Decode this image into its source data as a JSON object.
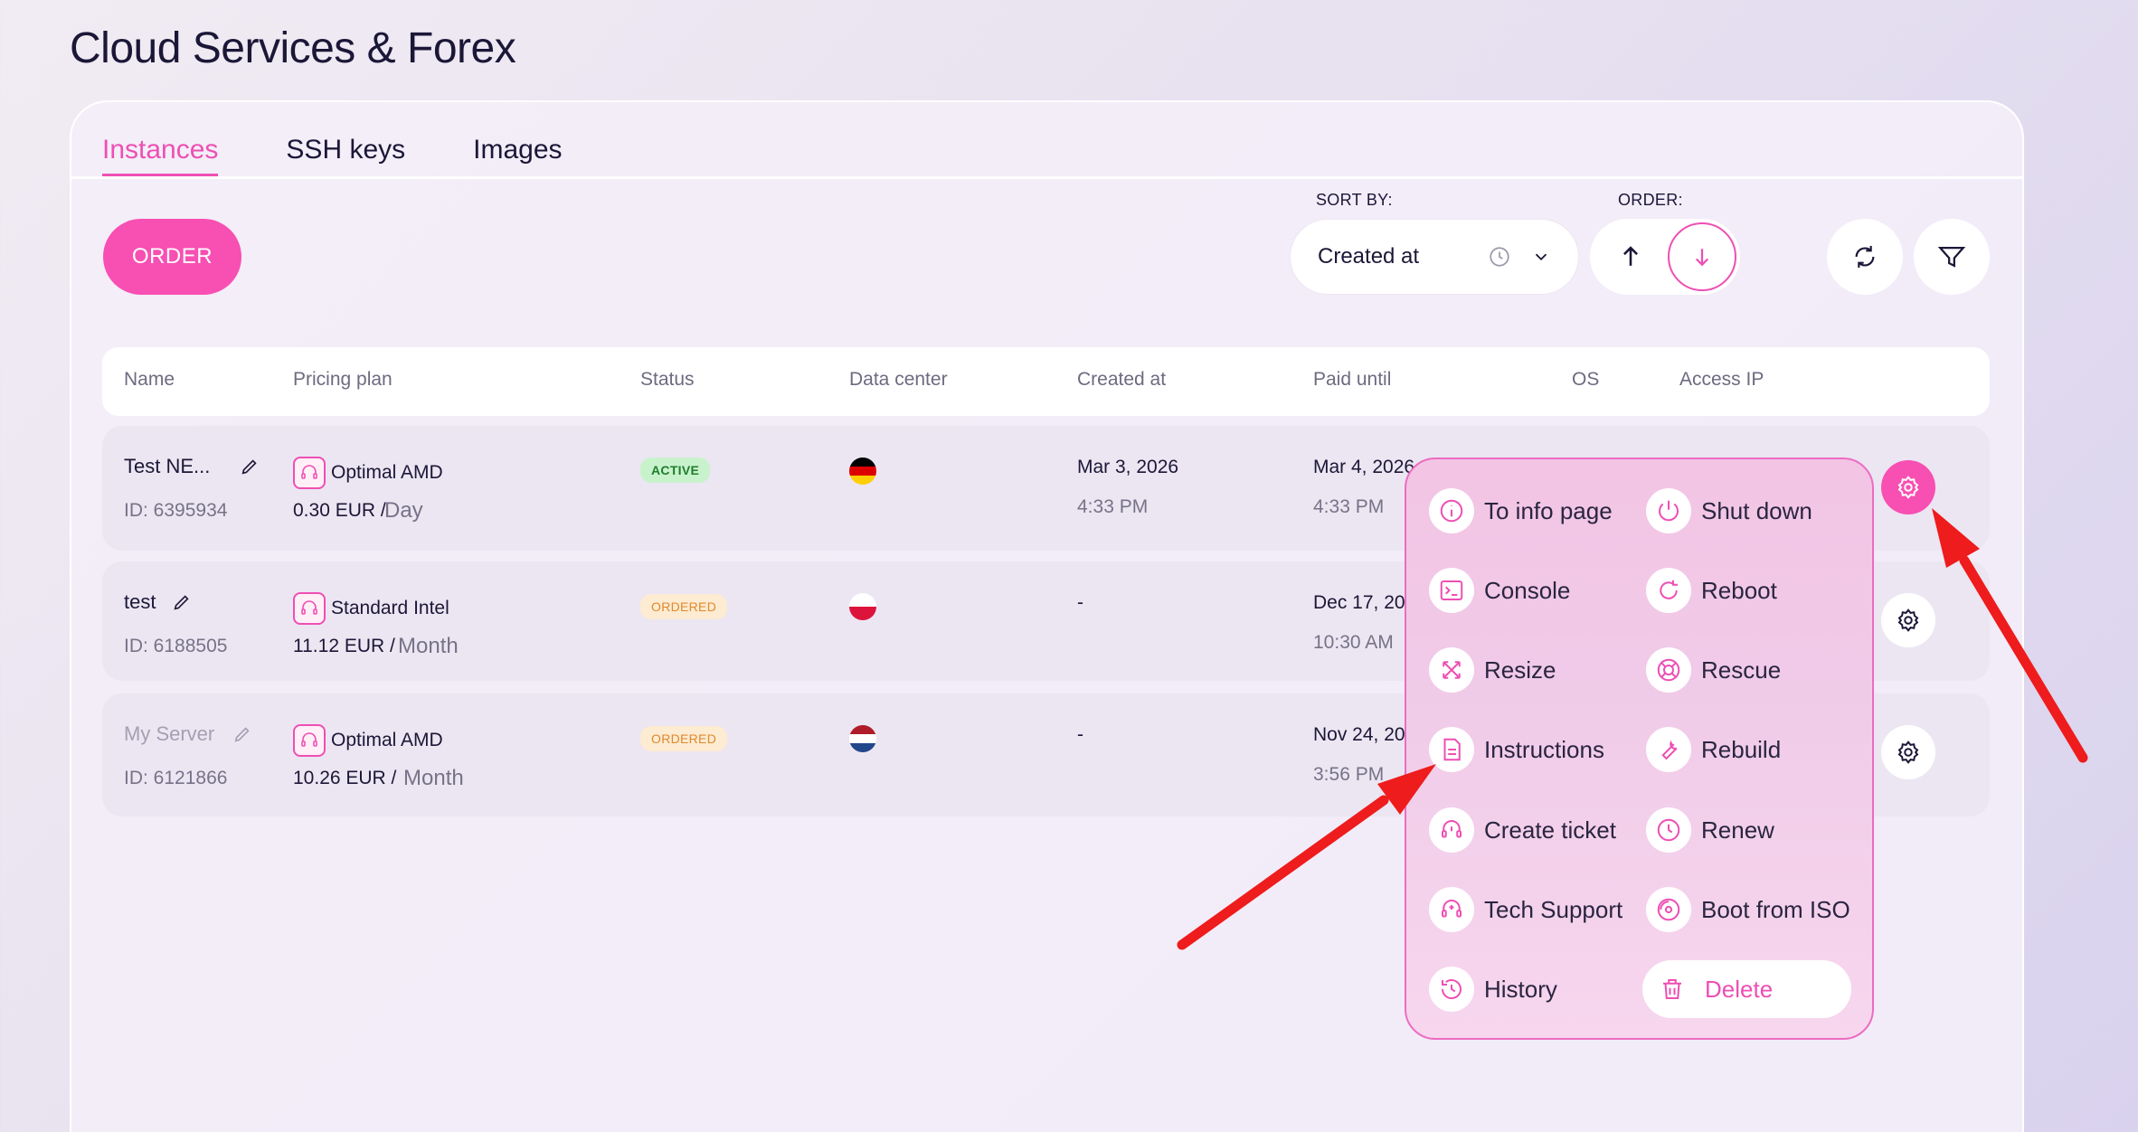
{
  "page": {
    "title": "Cloud Services & Forex"
  },
  "tabs": [
    {
      "label": "Instances",
      "active": true
    },
    {
      "label": "SSH keys",
      "active": false
    },
    {
      "label": "Images",
      "active": false
    }
  ],
  "toolbar": {
    "order_label": "ORDER",
    "sort_label": "SORT BY:",
    "sort_value": "Created at",
    "order_label_text": "ORDER:",
    "order_direction": "descending"
  },
  "table": {
    "columns": [
      "Name",
      "Pricing plan",
      "Status",
      "Data center",
      "Created at",
      "Paid until",
      "OS",
      "Access IP"
    ],
    "rows": [
      {
        "name": "Test NE...",
        "id": "ID: 6395934",
        "plan": "Optimal AMD",
        "price": "0.30 EUR /",
        "period": "Day",
        "status": "ACTIVE",
        "flag": "germany",
        "created_date": "Mar 3, 2026",
        "created_time": "4:33 PM",
        "paid_date": "Mar 4, 2026",
        "paid_time": "4:33 PM"
      },
      {
        "name": "test",
        "id": "ID: 6188505",
        "plan": "Standard Intel",
        "price": "11.12 EUR /",
        "period": "Month",
        "status": "ORDERED",
        "flag": "poland",
        "created_date": "-",
        "created_time": "",
        "paid_date": "Dec 17, 202",
        "paid_time": "10:30 AM"
      },
      {
        "name": "My Server",
        "id": "ID: 6121866",
        "plan": "Optimal AMD",
        "price": "10.26 EUR /",
        "period": "Month",
        "status": "ORDERED",
        "flag": "netherlands",
        "created_date": "-",
        "created_time": "",
        "paid_date": "Nov 24, 20",
        "paid_time": "3:56 PM"
      }
    ]
  },
  "menu": {
    "left": [
      "To info page",
      "Console",
      "Resize",
      "Instructions",
      "Create ticket",
      "Tech Support",
      "History"
    ],
    "right": [
      "Shut down",
      "Reboot",
      "Rescue",
      "Rebuild",
      "Renew",
      "Boot from ISO",
      "Delete"
    ]
  },
  "colors": {
    "accent": "#f84fb3",
    "active_badge_bg": "#c8f2cc",
    "ordered_badge_bg": "#fdebd2",
    "annotation_arrow": "#ee1c1c"
  }
}
